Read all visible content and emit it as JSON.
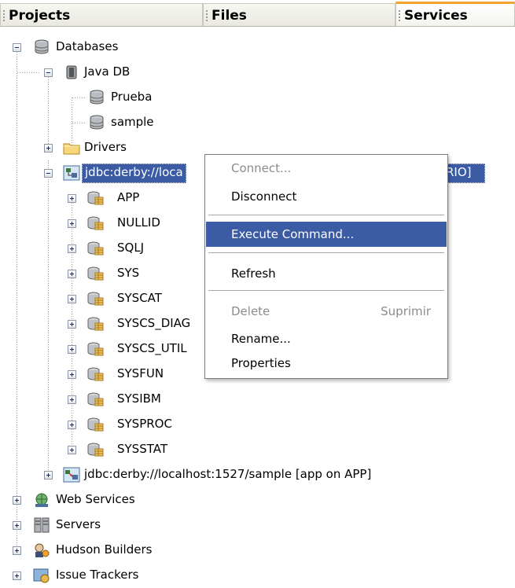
{
  "tabs": [
    {
      "label": "Projects",
      "active": false
    },
    {
      "label": "Files",
      "active": false
    },
    {
      "label": "Services",
      "active": true
    }
  ],
  "tree": {
    "databases": "Databases",
    "java_db": "Java DB",
    "prueba": "Prueba",
    "sample": "sample",
    "drivers": "Drivers",
    "connection1_visible_left": "jdbc:derby://loca",
    "connection1_visible_right": "RIO]",
    "schemas": [
      "APP",
      "NULLID",
      "SQLJ",
      "SYS",
      "SYSCAT",
      "SYSCS_DIAG",
      "SYSCS_UTIL",
      "SYSFUN",
      "SYSIBM",
      "SYSPROC",
      "SYSSTAT"
    ],
    "connection2": "jdbc:derby://localhost:1527/sample [app on APP]",
    "web_services": "Web Services",
    "servers": "Servers",
    "hudson": "Hudson Builders",
    "issue_trackers": "Issue Trackers"
  },
  "context_menu": {
    "connect": "Connect...",
    "disconnect": "Disconnect",
    "execute": "Execute Command...",
    "refresh": "Refresh",
    "delete": "Delete",
    "delete_accel": "Suprimir",
    "rename": "Rename...",
    "properties": "Properties"
  },
  "colors": {
    "selection": "#3b5ba5",
    "active_tab_accent": "#f2a32b"
  }
}
